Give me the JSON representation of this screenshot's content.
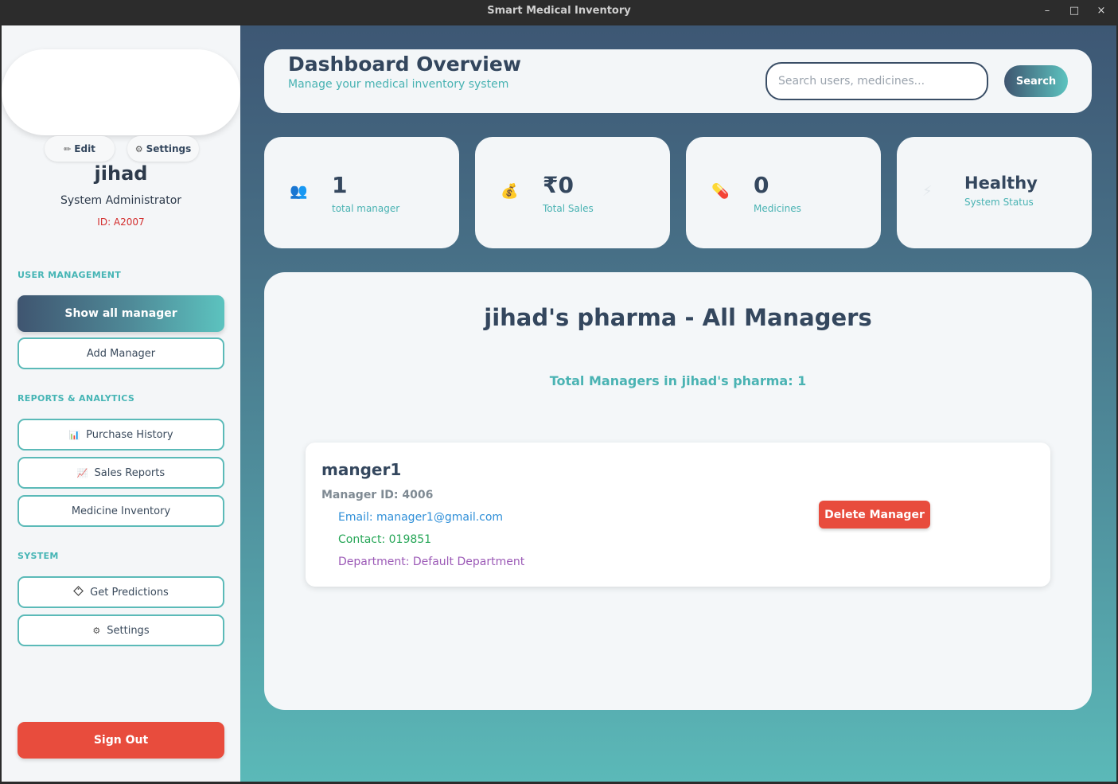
{
  "window": {
    "title": "Smart Medical Inventory",
    "controls": {
      "minimize": "–",
      "maximize": "□",
      "close": "×"
    }
  },
  "sidebar": {
    "profile": {
      "edit_label": "Edit",
      "settings_label": "Settings",
      "edit_icon": "pencil-icon",
      "settings_icon": "gear-icon",
      "name": "jihad",
      "role": "System Administrator",
      "id_text": "ID: A2007"
    },
    "sections": {
      "user_management": "USER MANAGEMENT",
      "reports": "REPORTS & ANALYTICS",
      "system": "SYSTEM"
    },
    "items": {
      "show_all_manager": "Show all manager",
      "add_manager": "Add Manager",
      "purchase_history": "Purchase History",
      "sales_reports": "Sales Reports",
      "medicine_inventory": "Medicine Inventory",
      "get_predictions": "Get Predictions",
      "settings": "Settings"
    },
    "sign_out": "Sign Out"
  },
  "header": {
    "title": "Dashboard Overview",
    "subtitle": "Manage your medical inventory system",
    "search_placeholder": "Search users, medicines...",
    "search_button": "Search"
  },
  "stats": [
    {
      "value": "1",
      "label": "total manager",
      "icon": "users-icon"
    },
    {
      "value": "₹0",
      "label": "Total Sales",
      "icon": "money-bag-icon"
    },
    {
      "value": "0",
      "label": "Medicines",
      "icon": "pill-icon"
    },
    {
      "value": "Healthy",
      "label": "System Status",
      "icon": "lightning-icon"
    }
  ],
  "content": {
    "title": "jihad's pharma - All Managers",
    "total_text": "Total Managers in jihad's pharma: 1",
    "manager": {
      "name": "manger1",
      "id_text": "Manager ID: 4006",
      "email_text": "Email: manager1@gmail.com",
      "contact_text": "Contact: 019851",
      "department_text": "Department: Default Department",
      "delete_label": "Delete Manager"
    }
  },
  "colors": {
    "accent_teal": "#5bbab8",
    "navy": "#34475e",
    "danger": "#e84c3d",
    "email": "#2f8fd8",
    "contact": "#26a657",
    "department": "#9b59b6"
  }
}
